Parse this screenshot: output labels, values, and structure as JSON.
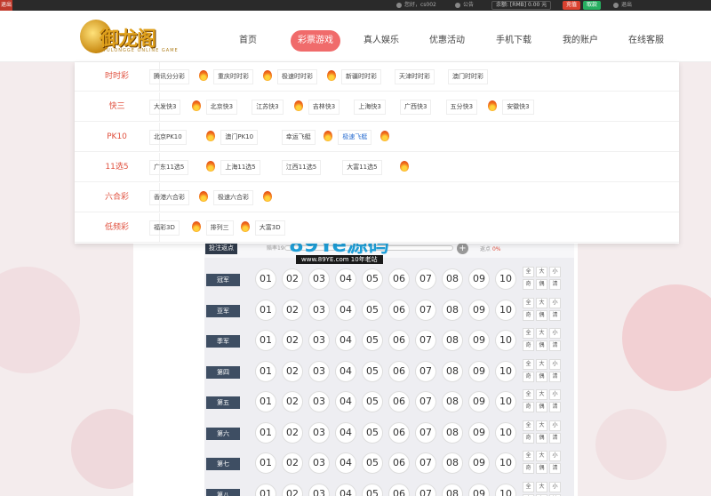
{
  "topbar": {
    "left_badge": "退出",
    "greeting": "您好，cs002",
    "notice": "公告",
    "balance": "余额: [RMB] 0.00 元",
    "charge": "充值",
    "withdraw": "取款",
    "logout": "退出"
  },
  "logo": {
    "text": "御龙阁",
    "subtitle": "YULONGGE ONLINE GAME"
  },
  "nav": [
    "首页",
    "彩票游戏",
    "真人娱乐",
    "优惠活动",
    "手机下载",
    "我的账户",
    "在线客服"
  ],
  "nav_active_index": 1,
  "menu": [
    {
      "category": "时时彩",
      "items": [
        {
          "label": "腾讯分分彩",
          "hot": true
        },
        {
          "label": "重庆时时彩",
          "hot": true
        },
        {
          "label": "极速时时彩",
          "hot": true
        },
        {
          "label": "新疆时时彩",
          "hot": false
        },
        {
          "label": "天津时时彩",
          "hot": false
        },
        {
          "label": "澳门时时彩",
          "hot": false
        }
      ]
    },
    {
      "category": "快三",
      "items": [
        {
          "label": "大发快3",
          "hot": true
        },
        {
          "label": "北京快3",
          "hot": false
        },
        {
          "label": "江苏快3",
          "hot": true
        },
        {
          "label": "吉林快3",
          "hot": false
        },
        {
          "label": "上海快3",
          "hot": false
        },
        {
          "label": "广西快3",
          "hot": false
        },
        {
          "label": "五分快3",
          "hot": true
        },
        {
          "label": "安徽快3",
          "hot": false
        }
      ]
    },
    {
      "category": "PK10",
      "items": [
        {
          "label": "北京PK10",
          "hot": true
        },
        {
          "label": "澳门PK10",
          "hot": false
        },
        {
          "label": "幸运飞艇",
          "hot": true
        },
        {
          "label": "极速飞艇",
          "hot": true,
          "blue": true
        }
      ]
    },
    {
      "category": "11选5",
      "items": [
        {
          "label": "广东11选5",
          "hot": true
        },
        {
          "label": "上海11选5",
          "hot": false
        },
        {
          "label": "江西11选5",
          "hot": false
        },
        {
          "label": "大富11选5",
          "hot": true
        }
      ]
    },
    {
      "category": "六合彩",
      "items": [
        {
          "label": "香港六合彩",
          "hot": true
        },
        {
          "label": "极速六合彩",
          "hot": true
        }
      ]
    },
    {
      "category": "低频彩",
      "items": [
        {
          "label": "福彩3D",
          "hot": true
        },
        {
          "label": "排列三",
          "hot": true
        },
        {
          "label": "大富3D",
          "hot": false
        }
      ]
    }
  ],
  "bet": {
    "tag": "投注返点",
    "odds_label": "赔率19",
    "rebate_label": "返点",
    "rebate_value": "0%"
  },
  "rows": [
    {
      "label": "冠军"
    },
    {
      "label": "亚军"
    },
    {
      "label": "季军"
    },
    {
      "label": "第四"
    },
    {
      "label": "第五"
    },
    {
      "label": "第六"
    },
    {
      "label": "第七"
    },
    {
      "label": "第八"
    }
  ],
  "balls": [
    "01",
    "02",
    "03",
    "04",
    "05",
    "06",
    "07",
    "08",
    "09",
    "10"
  ],
  "quick": [
    "全",
    "大",
    "小",
    "奇",
    "偶",
    "清"
  ],
  "watermark": {
    "main": "89Ye源码",
    "sub": "www.89YE.com    10年老站"
  }
}
